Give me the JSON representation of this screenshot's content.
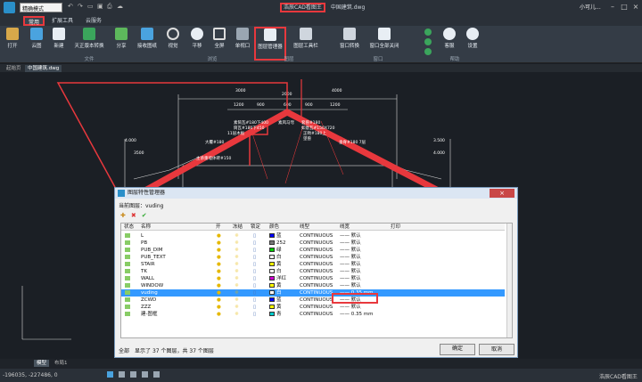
{
  "titlebar": {
    "mode": "精确模式",
    "app_title": "浩辰CAD看图王",
    "doc_title": "中国建筑.dwg",
    "user": "小可儿..."
  },
  "tabs": [
    "常用",
    "扩展工具",
    "云服务"
  ],
  "ribbon": {
    "buttons": [
      "打开",
      "云图",
      "新建",
      "天正版本转换",
      "分享",
      "接收图纸",
      "视觉",
      "平移",
      "全屏",
      "单视口",
      "图层管理器",
      "图层工具栏",
      "窗口转换",
      "窗口全部关闭",
      "客服",
      "设置"
    ],
    "groups": [
      "文件",
      "浏览",
      "图层",
      "窗口",
      "帮助"
    ]
  },
  "doc_tabs": [
    "起始页",
    "中国建筑.dwg"
  ],
  "drawing": {
    "dims": [
      "2000",
      "3000",
      "1200",
      "900",
      "600",
      "900",
      "1200",
      "4000",
      "3500",
      "4.000",
      "3.500",
      "4.000"
    ],
    "notes": [
      "素筒瓦#180下400",
      "筒瓦#180下450",
      "素风马穹",
      "套兽#180",
      "如意瓦#150X720",
      "11层木板",
      "大覆#180",
      "正吻#180上",
      "望兽",
      "垂脊#180 7层",
      "主承重墙体砖#150"
    ]
  },
  "bottom_tabs": [
    "模型",
    "布局1"
  ],
  "status": {
    "coords": "-196035, -227486, 0",
    "right": "浩辰CAD看图王"
  },
  "dialog": {
    "title": "图层特性管理器",
    "current_layer_label": "当前图层：",
    "current_layer": "vuding",
    "columns": [
      "状态",
      "名称",
      "开",
      "冻结",
      "锁定",
      "颜色",
      "线型",
      "线宽",
      "打印"
    ],
    "rows": [
      {
        "name": "L",
        "color_name": "蓝",
        "color": "#0000ff",
        "linetype": "CONTINUOUS",
        "lineweight": "默认"
      },
      {
        "name": "PB",
        "color_name": "252",
        "color": "#777777",
        "linetype": "CONTINUOUS",
        "lineweight": "默认"
      },
      {
        "name": "PUB_DIM",
        "color_name": "绿",
        "color": "#00cc00",
        "linetype": "CONTINUOUS",
        "lineweight": "默认"
      },
      {
        "name": "PUB_TEXT",
        "color_name": "白",
        "color": "#ffffff",
        "linetype": "CONTINUOUS",
        "lineweight": "默认"
      },
      {
        "name": "STAIR",
        "color_name": "黄",
        "color": "#ffff00",
        "linetype": "CONTINUOUS",
        "lineweight": "默认"
      },
      {
        "name": "TK",
        "color_name": "白",
        "color": "#ffffff",
        "linetype": "CONTINUOUS",
        "lineweight": "默认"
      },
      {
        "name": "WALL",
        "color_name": "洋红",
        "color": "#cc00cc",
        "linetype": "CONTINUOUS",
        "lineweight": "默认"
      },
      {
        "name": "WINDOW",
        "color_name": "黄",
        "color": "#ffff00",
        "linetype": "CONTINUOUS",
        "lineweight": "默认"
      },
      {
        "name": "vuding",
        "color_name": "白",
        "color": "#ffffff",
        "linetype": "CONTINUOUS",
        "lineweight": "0.35 mm"
      },
      {
        "name": "ZCWD",
        "color_name": "蓝",
        "color": "#0000ff",
        "linetype": "CONTINUOUS",
        "lineweight": "默认"
      },
      {
        "name": "ZZZ",
        "color_name": "黄",
        "color": "#ffff00",
        "linetype": "CONTINUOUS",
        "lineweight": "默认"
      },
      {
        "name": "建-图框",
        "color_name": "青",
        "color": "#00cccc",
        "linetype": "CONTINUOUS",
        "lineweight": "0.35 mm"
      }
    ],
    "filter": "全部",
    "info": "显示了 37 个图层，共 37 个图层",
    "ok": "确定",
    "cancel": "取消"
  },
  "colors": {
    "highlight": "#e8383d",
    "accent": "#2a8fc9"
  }
}
